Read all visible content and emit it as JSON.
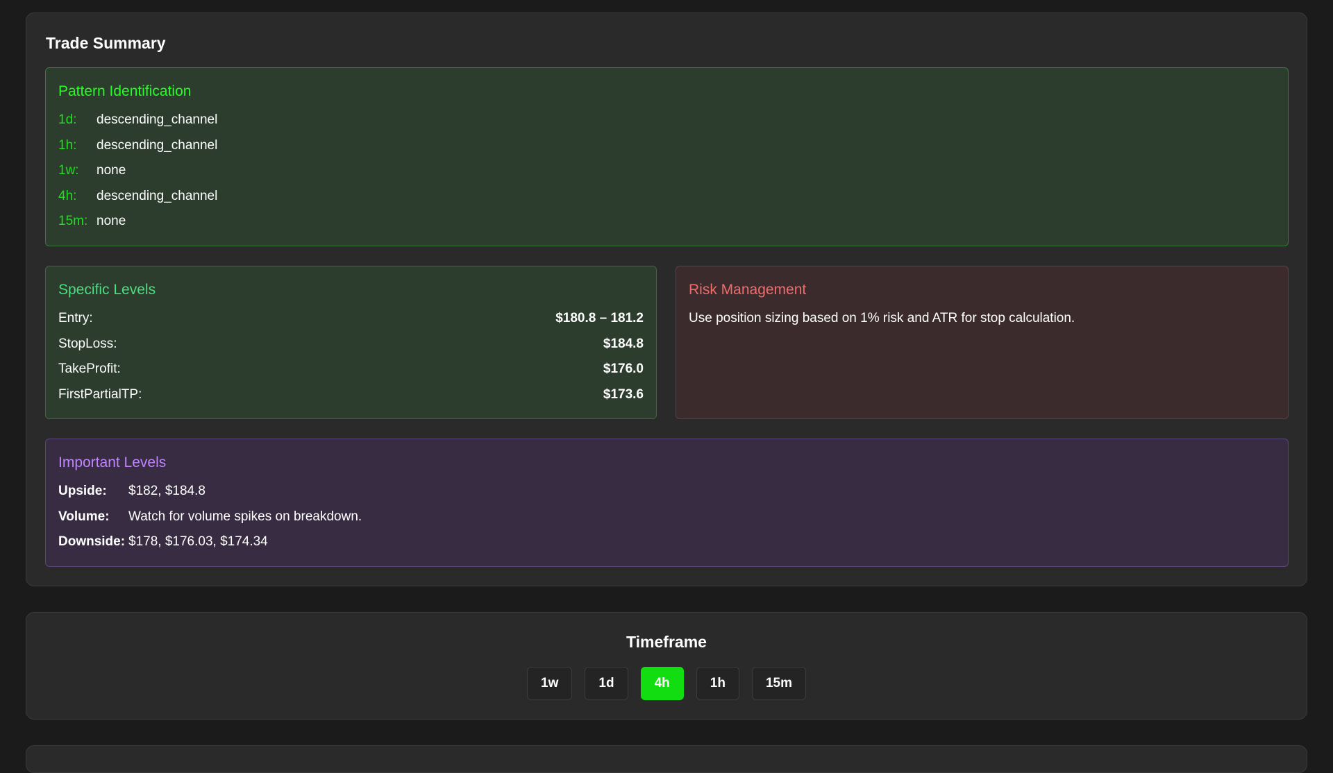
{
  "summary": {
    "title": "Trade Summary",
    "pattern": {
      "title": "Pattern Identification",
      "rows": [
        {
          "key": "1d:",
          "value": "descending_channel"
        },
        {
          "key": "1h:",
          "value": "descending_channel"
        },
        {
          "key": "1w:",
          "value": "none"
        },
        {
          "key": "4h:",
          "value": "descending_channel"
        },
        {
          "key": "15m:",
          "value": "none"
        }
      ]
    },
    "specific_levels": {
      "title": "Specific Levels",
      "rows": [
        {
          "key": "Entry:",
          "value": "$180.8 – 181.2"
        },
        {
          "key": "StopLoss:",
          "value": "$184.8"
        },
        {
          "key": "TakeProfit:",
          "value": "$176.0"
        },
        {
          "key": "FirstPartialTP:",
          "value": "$173.6"
        }
      ]
    },
    "risk": {
      "title": "Risk Management",
      "text": "Use position sizing based on 1% risk and ATR for stop calculation."
    },
    "important_levels": {
      "title": "Important Levels",
      "rows": [
        {
          "key": "Upside:",
          "value": "$182, $184.8"
        },
        {
          "key": "Volume:",
          "value": "Watch for volume spikes on breakdown."
        },
        {
          "key": "Downside:",
          "value": "$178, $176.03, $174.34"
        }
      ]
    }
  },
  "timeframe": {
    "title": "Timeframe",
    "options": [
      "1w",
      "1d",
      "4h",
      "1h",
      "15m"
    ],
    "selected": "4h"
  },
  "colors": {
    "accent_green": "#11dd11",
    "pattern_title": "#22ff22",
    "levels_title": "#4ade80",
    "risk_title": "#f26b6b",
    "important_title": "#c084fc"
  }
}
